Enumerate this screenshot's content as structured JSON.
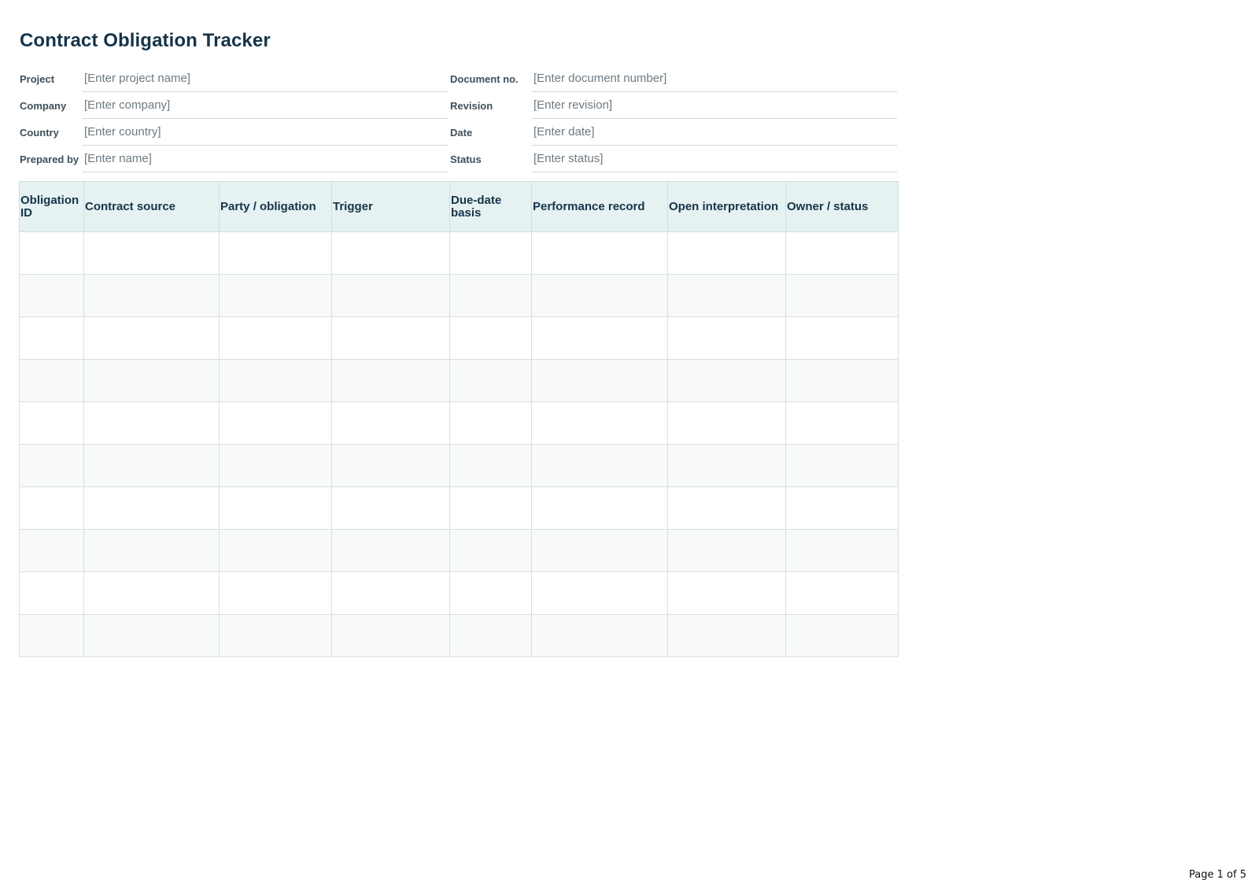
{
  "title": "Contract Obligation Tracker",
  "meta": {
    "rows": [
      {
        "left_label": "Project",
        "left_value": "[Enter project name]",
        "right_label": "Document no.",
        "right_value": "[Enter document number]"
      },
      {
        "left_label": "Company",
        "left_value": "[Enter company]",
        "right_label": "Revision",
        "right_value": "[Enter revision]"
      },
      {
        "left_label": "Country",
        "left_value": "[Enter country]",
        "right_label": "Date",
        "right_value": "[Enter date]"
      },
      {
        "left_label": "Prepared by",
        "left_value": "[Enter name]",
        "right_label": "Status",
        "right_value": "[Enter status]"
      }
    ]
  },
  "table": {
    "columns": [
      "Obligation ID",
      "Contract source",
      "Party / obligation",
      "Trigger",
      "Due-date basis",
      "Performance record",
      "Open interpretation",
      "Owner / status"
    ],
    "rows": [
      [
        "",
        "",
        "",
        "",
        "",
        "",
        "",
        ""
      ],
      [
        "",
        "",
        "",
        "",
        "",
        "",
        "",
        ""
      ],
      [
        "",
        "",
        "",
        "",
        "",
        "",
        "",
        ""
      ],
      [
        "",
        "",
        "",
        "",
        "",
        "",
        "",
        ""
      ],
      [
        "",
        "",
        "",
        "",
        "",
        "",
        "",
        ""
      ],
      [
        "",
        "",
        "",
        "",
        "",
        "",
        "",
        ""
      ],
      [
        "",
        "",
        "",
        "",
        "",
        "",
        "",
        ""
      ],
      [
        "",
        "",
        "",
        "",
        "",
        "",
        "",
        ""
      ],
      [
        "",
        "",
        "",
        "",
        "",
        "",
        "",
        ""
      ],
      [
        "",
        "",
        "",
        "",
        "",
        "",
        "",
        ""
      ]
    ]
  },
  "footer": {
    "page_label": "Page 1 of 5"
  }
}
